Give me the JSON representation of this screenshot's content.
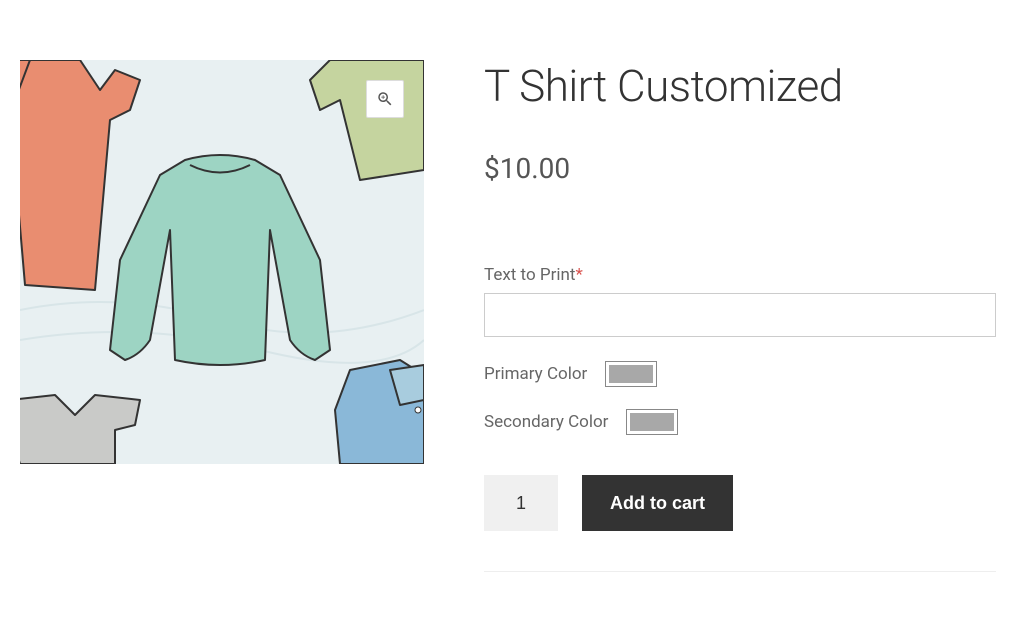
{
  "product": {
    "title": "T Shirt Customized",
    "price": "$10.00"
  },
  "form": {
    "text_print_label": "Text to Print",
    "text_print_required": "*",
    "primary_color_label": "Primary Color",
    "secondary_color_label": "Secondary Color",
    "primary_color_value": "#a8a8a8",
    "secondary_color_value": "#a8a8a8",
    "text_print_value": ""
  },
  "cart": {
    "quantity": "1",
    "add_label": "Add to cart"
  },
  "icons": {
    "zoom": "zoom-in"
  }
}
